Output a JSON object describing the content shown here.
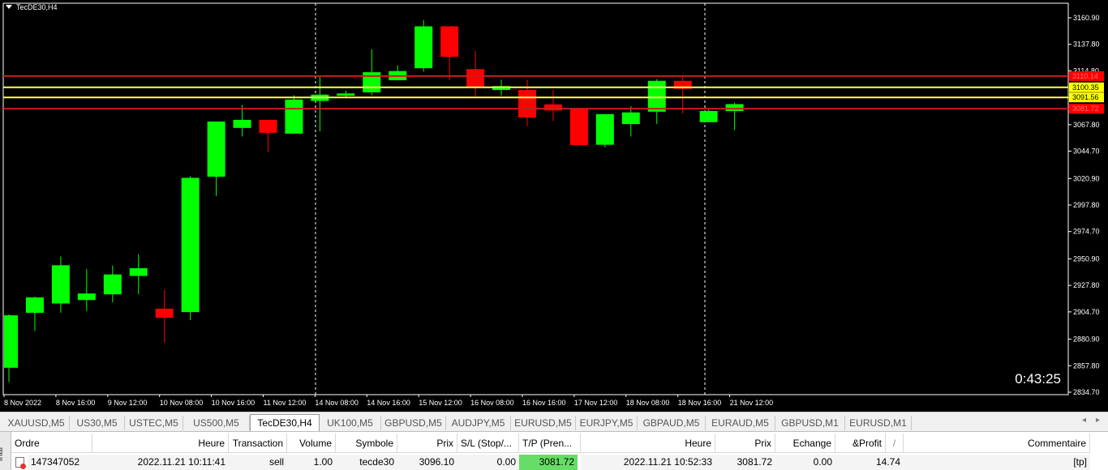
{
  "chart_window": {
    "title": "TecDE30,H4",
    "countdown": "0:43:25"
  },
  "chart_data": {
    "type": "candlestick",
    "symbol": "TecDE30",
    "timeframe": "H4",
    "ylim": [
      2834.7,
      3160.9
    ],
    "y_ticks": [
      "3160.90",
      "3137.80",
      "3114.80",
      "3091.60",
      "3067.80",
      "3044.70",
      "3020.90",
      "2997.80",
      "2974.70",
      "2950.90",
      "2927.80",
      "2904.70",
      "2880.90",
      "2857.80",
      "2834.70"
    ],
    "x_ticks": [
      "8 Nov 2022",
      "8 Nov 16:00",
      "9 Nov 12:00",
      "10 Nov 08:00",
      "10 Nov 16:00",
      "11 Nov 12:00",
      "14 Nov 08:00",
      "14 Nov 16:00",
      "15 Nov 12:00",
      "16 Nov 08:00",
      "16 Nov 16:00",
      "17 Nov 12:00",
      "18 Nov 08:00",
      "18 Nov 16:00",
      "21 Nov 12:00"
    ],
    "bull_color": "#00ff00",
    "bear_color": "#ff0000",
    "candles": [
      {
        "o": 2856.0,
        "h": 2902.5,
        "l": 2843.5,
        "c": 2901.7
      },
      {
        "o": 2903.9,
        "h": 2918.0,
        "l": 2888.0,
        "c": 2917.3
      },
      {
        "o": 2912.0,
        "h": 2953.0,
        "l": 2904.0,
        "c": 2945.3
      },
      {
        "o": 2915.0,
        "h": 2942.0,
        "l": 2905.5,
        "c": 2920.7
      },
      {
        "o": 2920.0,
        "h": 2945.0,
        "l": 2913.0,
        "c": 2937.3
      },
      {
        "o": 2936.0,
        "h": 2955.0,
        "l": 2920.0,
        "c": 2942.7
      },
      {
        "o": 2907.5,
        "h": 2924.0,
        "l": 2878.0,
        "c": 2899.5
      },
      {
        "o": 2904.5,
        "h": 3023.0,
        "l": 2897.5,
        "c": 3021.5
      },
      {
        "o": 3022.5,
        "h": 3070.5,
        "l": 3005.5,
        "c": 3070.5
      },
      {
        "o": 3065.0,
        "h": 3085.0,
        "l": 3057.5,
        "c": 3072.0
      },
      {
        "o": 3072.0,
        "h": 3072.0,
        "l": 3044.0,
        "c": 3060.7
      },
      {
        "o": 3060.0,
        "h": 3093.5,
        "l": 3060.0,
        "c": 3089.7
      },
      {
        "o": 3088.5,
        "h": 3109.5,
        "l": 3062.0,
        "c": 3094.0
      },
      {
        "o": 3093.0,
        "h": 3097.5,
        "l": 3092.0,
        "c": 3095.0
      },
      {
        "o": 3096.0,
        "h": 3133.5,
        "l": 3093.5,
        "c": 3113.5
      },
      {
        "o": 3106.5,
        "h": 3119.5,
        "l": 3106.5,
        "c": 3114.5
      },
      {
        "o": 3117.0,
        "h": 3159.0,
        "l": 3114.0,
        "c": 3153.5
      },
      {
        "o": 3153.5,
        "h": 3153.5,
        "l": 3106.5,
        "c": 3127.0
      },
      {
        "o": 3116.2,
        "h": 3132.0,
        "l": 3092.5,
        "c": 3099.8
      },
      {
        "o": 3098.0,
        "h": 3107.0,
        "l": 3093.0,
        "c": 3101.4
      },
      {
        "o": 3098.0,
        "h": 3107.0,
        "l": 3066.5,
        "c": 3074.0
      },
      {
        "o": 3085.5,
        "h": 3098.0,
        "l": 3071.0,
        "c": 3080.2
      },
      {
        "o": 3081.5,
        "h": 3081.5,
        "l": 3050.0,
        "c": 3050.0
      },
      {
        "o": 3050.3,
        "h": 3077.0,
        "l": 3048.0,
        "c": 3077.0
      },
      {
        "o": 3068.3,
        "h": 3084.0,
        "l": 3057.5,
        "c": 3078.5
      },
      {
        "o": 3079.1,
        "h": 3107.5,
        "l": 3068.5,
        "c": 3106.0
      },
      {
        "o": 3106.0,
        "h": 3110.5,
        "l": 3077.5,
        "c": 3099.0
      },
      {
        "o": 3070.0,
        "h": 3081.5,
        "l": 3070.0,
        "c": 3079.7
      },
      {
        "o": 3079.7,
        "h": 3087.0,
        "l": 3063.0,
        "c": 3085.7
      }
    ],
    "levels": [
      {
        "price": 3110.14,
        "label": "3110.14",
        "color": "#cc1b1b",
        "label_bg": "#ff0000",
        "label_fg": "#ff7070"
      },
      {
        "price": 3100.35,
        "label": "3100.35",
        "color": "#ffff4a",
        "label_bg": "#ffff00",
        "label_fg": "#000000"
      },
      {
        "price": 3091.56,
        "label": "3091.56",
        "color": "#ffff4a",
        "label_bg": "#ffff00",
        "label_fg": "#000000"
      },
      {
        "price": 3081.72,
        "label": "3081.72",
        "color": "#cc1b1b",
        "label_bg": "#ff0000",
        "label_fg": "#ff7070"
      }
    ]
  },
  "symbol_tabs": [
    {
      "label": "XAUUSD,M5",
      "active": false
    },
    {
      "label": "US30,M5",
      "active": false
    },
    {
      "label": "USTEC,M5",
      "active": false
    },
    {
      "label": "US500,M5",
      "active": false
    },
    {
      "label": "TecDE30,H4",
      "active": true
    },
    {
      "label": "UK100,M5",
      "active": false
    },
    {
      "label": "GBPUSD,M5",
      "active": false
    },
    {
      "label": "AUDJPY,M5",
      "active": false
    },
    {
      "label": "EURUSD,M5",
      "active": false
    },
    {
      "label": "EURJPY,M5",
      "active": false
    },
    {
      "label": "GBPAUD,M5",
      "active": false
    },
    {
      "label": "EURAUD,M5",
      "active": false
    },
    {
      "label": "GBPUSD,M1",
      "active": false
    },
    {
      "label": "EURUSD,M1",
      "active": false
    }
  ],
  "tab_nav": {
    "prev": "◂",
    "next": "▸"
  },
  "terminal": {
    "side_label": "inal",
    "columns": [
      "Ordre",
      "Heure",
      "Transaction",
      "Volume",
      "Symbole",
      "Prix",
      "S/L (Stop/...",
      "T/P (Pren...",
      "Heure",
      "Prix",
      "Echange",
      "&Profit",
      "Commentaire"
    ],
    "sort_indicator": "/",
    "row": {
      "order": "147347052",
      "open_time": "2022.11.21 10:11:41",
      "type": "sell",
      "volume": "1.00",
      "symbol": "tecde30",
      "open_price": "3096.10",
      "sl": "0.00",
      "tp": "3081.72",
      "close_time": "2022.11.21 10:52:33",
      "close_price": "3081.72",
      "swap": "0.00",
      "profit": "14.74",
      "comment": "[tp]"
    },
    "tp_highlight": "#66dd66"
  }
}
